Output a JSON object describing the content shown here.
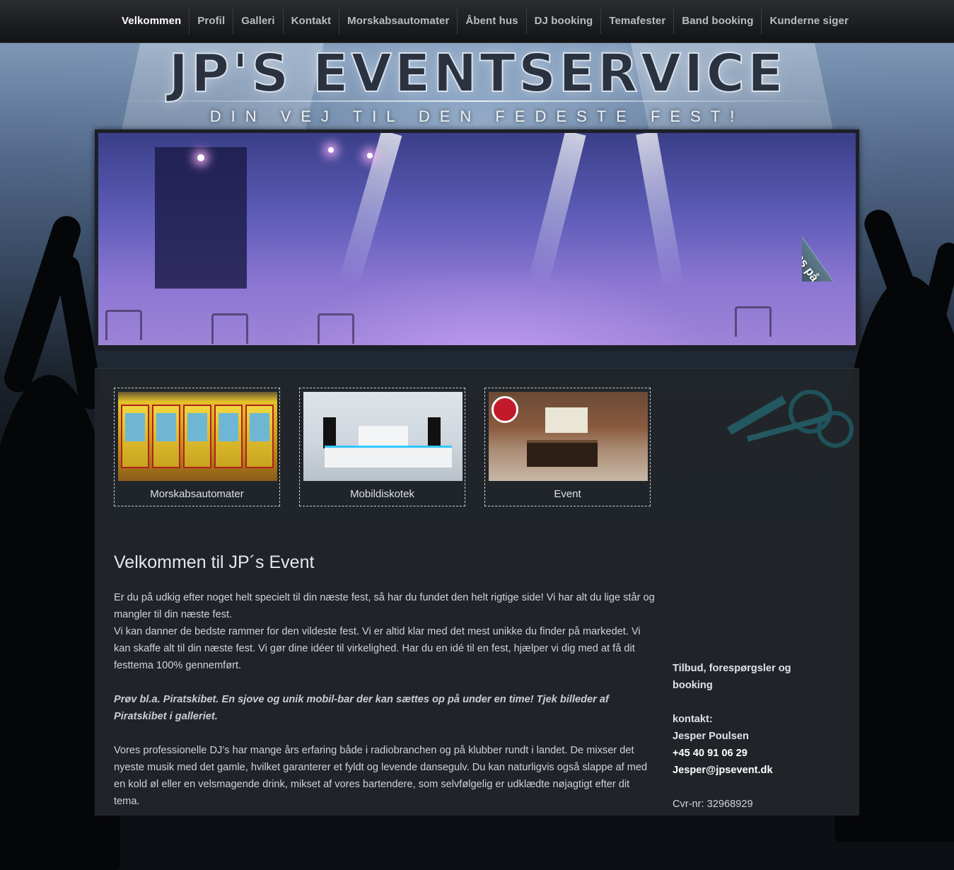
{
  "nav": {
    "items": [
      {
        "label": "Velkommen"
      },
      {
        "label": "Profil"
      },
      {
        "label": "Galleri"
      },
      {
        "label": "Kontakt"
      },
      {
        "label": "Morskabsautomater"
      },
      {
        "label": "Åbent hus"
      },
      {
        "label": "DJ booking"
      },
      {
        "label": "Temafester"
      },
      {
        "label": "Band booking"
      },
      {
        "label": "Kunderne siger"
      }
    ],
    "active": "Velkommen"
  },
  "header": {
    "logo": "JP'S EVENTSERVICE",
    "tagline": "DIN VEJ TIL DEN FEDESTE FEST!"
  },
  "banner": {
    "facebook_label": "Besøg os på Facebook",
    "facebook_icon": "f"
  },
  "tiles": [
    {
      "caption": "Morskabsautomater"
    },
    {
      "caption": "Mobildiskotek"
    },
    {
      "caption": "Event"
    }
  ],
  "main": {
    "title": "Velkommen til JP´s Event",
    "p1": "Er du på udkig efter noget helt specielt til din næste fest, så har du fundet den helt rigtige side! Vi har alt du lige står og mangler til din næste fest.",
    "p2": "Vi kan danner de bedste rammer for den vildeste fest. Vi er altid klar med det mest unikke du finder på markedet. Vi kan skaffe alt til din næste fest. Vi gør dine idéer til virkelighed. Har du en idé til en fest, hjælper vi dig med at få dit festtema 100% gennemført.",
    "p3": "Prøv bl.a. Piratskibet. En sjove og unik mobil-bar der kan sættes op på under en time! Tjek billeder af Piratskibet i galleriet.",
    "p4": "Vores professionelle DJ’s har mange års erfaring både i radiobranchen og på klubber rundt i landet. De mixser det nyeste musik med det gamle, hvilket garanterer et fyldt og levende dansegulv. Du kan naturligvis også slappe af med en kold øl eller en velsmagende drink, mikset af vores bartendere, som selvfølgelig er udklædte nøjagtigt efter dit tema."
  },
  "sidebar": {
    "heading": "Tilbud, forespørgsler og booking",
    "contact_label": "kontakt:",
    "name": "Jesper Poulsen",
    "phone": "+45 40 91 06 29",
    "email": "Jesper@jpsevent.dk",
    "cvr": "Cvr-nr: 32968929"
  }
}
